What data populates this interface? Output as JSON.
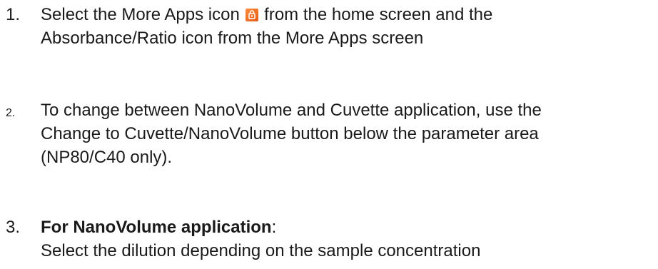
{
  "steps": [
    {
      "number": "1.",
      "line1_before_icon": "Select the More Apps icon ",
      "icon": "more-apps-icon",
      "line1_after_icon": " from the home screen and the",
      "line2": "Absorbance/Ratio icon from the More Apps screen"
    },
    {
      "number": "2.",
      "line1": "To change between NanoVolume and Cuvette application, use the",
      "line2": "Change to Cuvette/NanoVolume button below the parameter area",
      "line3": "(NP80/C40 only)."
    },
    {
      "number": "3.",
      "heading": "For NanoVolume application",
      "heading_suffix": ":",
      "line2": "Select the dilution depending on the sample concentration"
    }
  ]
}
